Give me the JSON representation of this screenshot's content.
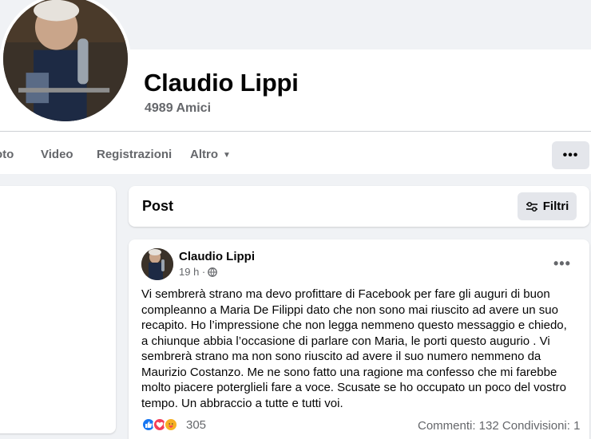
{
  "profile": {
    "name": "Claudio Lippi",
    "friends": "4989 Amici"
  },
  "tabs": {
    "photo": "oto",
    "video": "Video",
    "registrazioni": "Registrazioni",
    "altro": "Altro",
    "more": "•••"
  },
  "posts_header": {
    "title": "Post",
    "filter_label": "Filtri"
  },
  "post": {
    "author": "Claudio Lippi",
    "time": "19 h ·",
    "text": "Vi sembrerà strano ma devo profittare di Facebook per fare gli auguri di buon compleanno a Maria De Filippi dato che non sono mai riuscito ad avere un suo recapito. Ho l’impressione che non legga nemmeno questo messaggio e chiedo, a chiunque abbia l’occasione di parlare con Maria, le porti questo augurio . Vi sembrerà strano ma non sono riuscito ad avere il suo numero nemmeno da Maurizio Costanzo. Me ne sono fatto una ragione ma confesso che mi farebbe molto piacere poterglieli fare a voce. Scusate se ho occupato un poco del vostro tempo. Un abbraccio a tutte e tutti voi.",
    "reaction_count": "305",
    "comments": "Commenti: 132",
    "shares": "Condivisioni: 1",
    "reaction_icons": [
      "like-icon",
      "love-icon",
      "care-icon"
    ]
  },
  "colors": {
    "background": "#f0f2f5",
    "card": "#ffffff",
    "secondary_text": "#65676b",
    "button_gray": "#e4e6eb",
    "like_blue": "#1877f2",
    "love_red": "#f33e58"
  }
}
